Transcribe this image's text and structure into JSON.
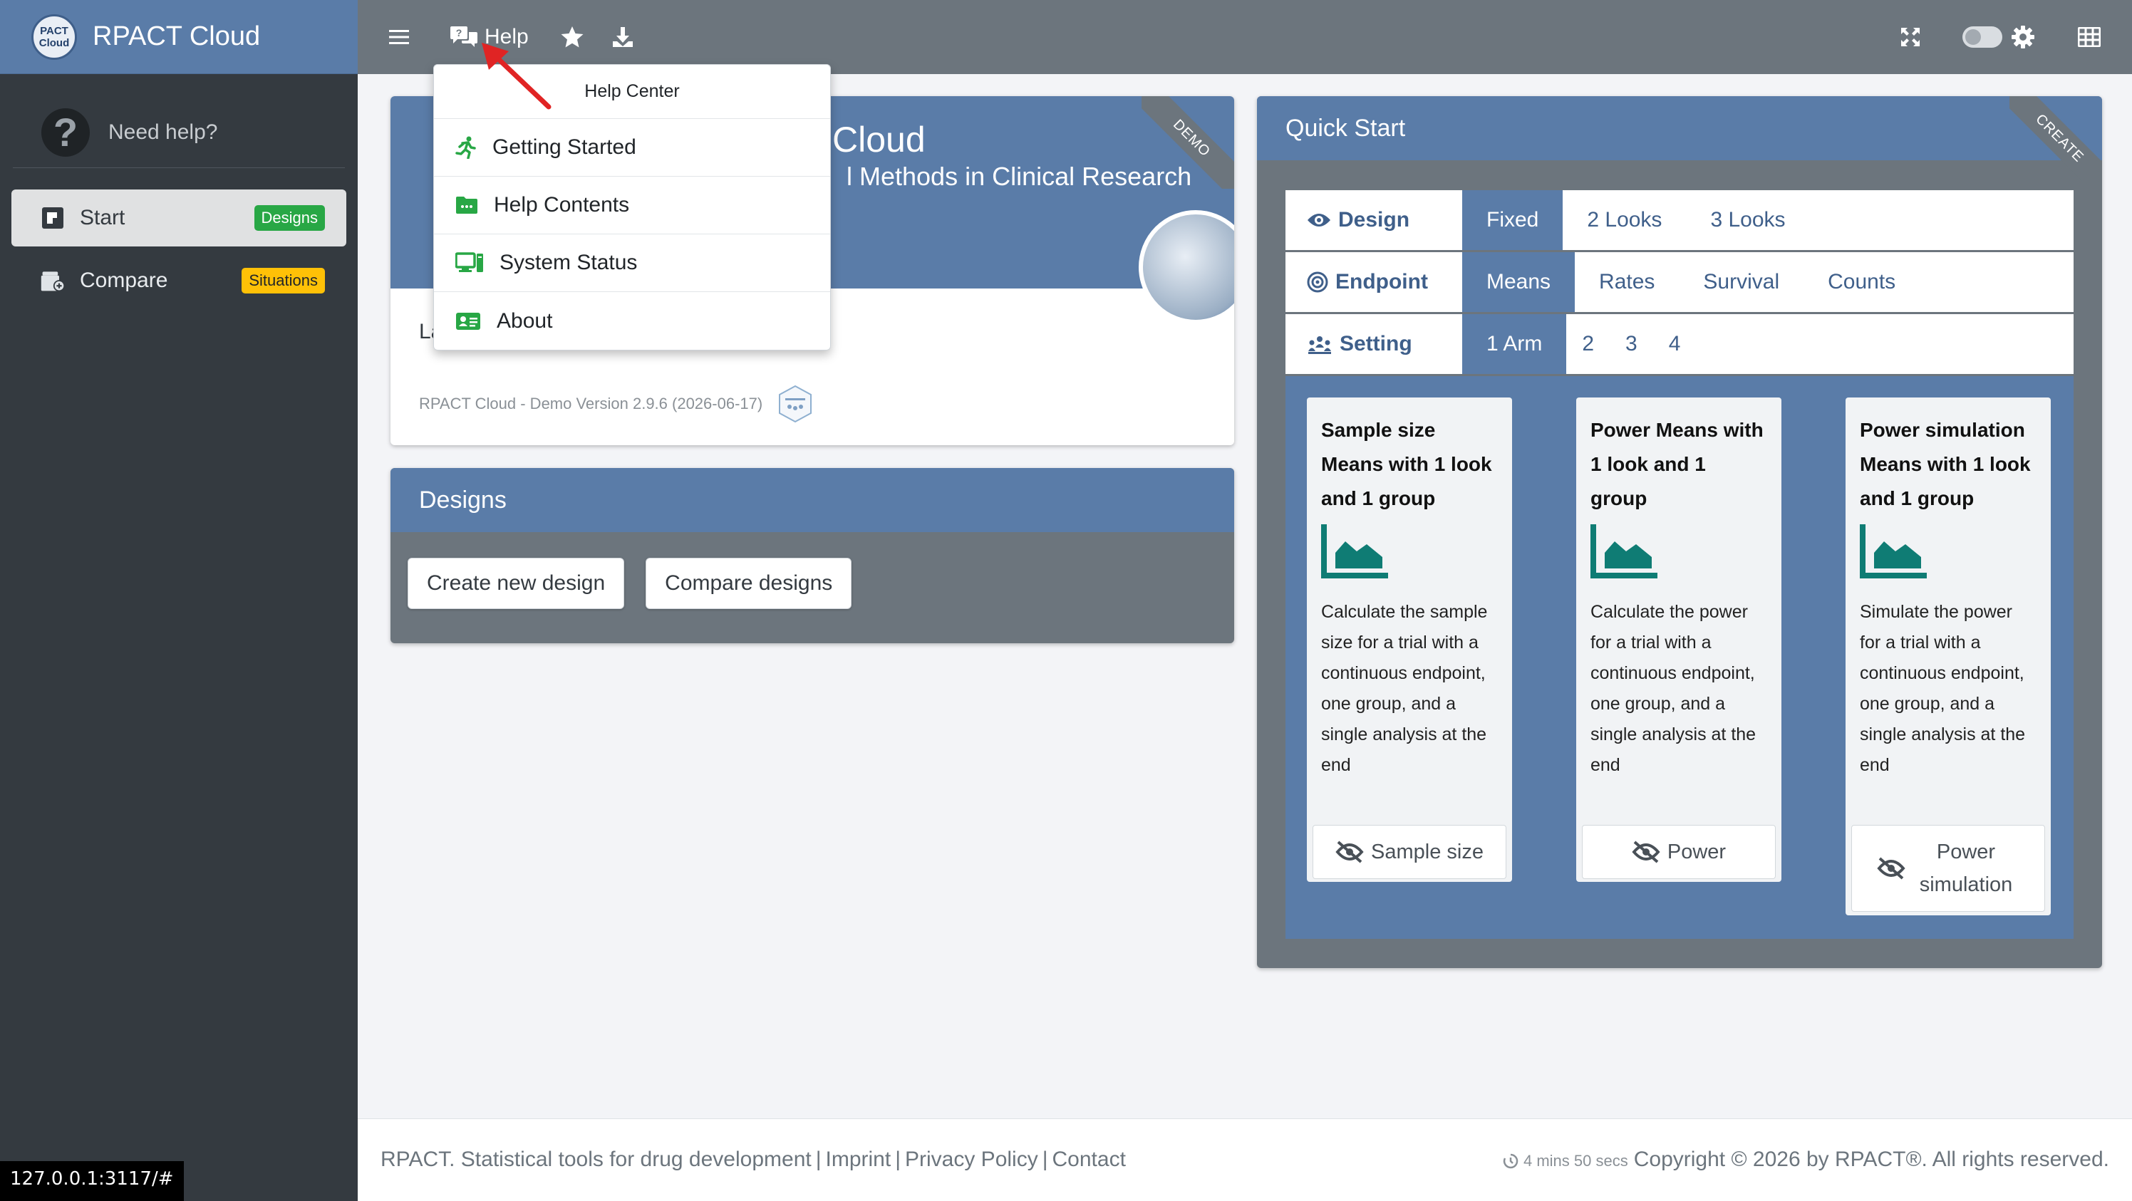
{
  "app": {
    "title": "RPACT Cloud",
    "logo_line1": "PACT",
    "logo_line2": "Cloud"
  },
  "sidebar": {
    "need_help": "Need help?",
    "items": [
      {
        "label": "Start",
        "badge": "Designs",
        "active": true,
        "icon": "start-icon",
        "badge_color": "#28a745"
      },
      {
        "label": "Compare",
        "badge": "Situations",
        "active": false,
        "icon": "compare-icon",
        "badge_color": "#ffc107"
      }
    ]
  },
  "topbar": {
    "help_label": "Help"
  },
  "help_menu": {
    "header": "Help Center",
    "items": [
      {
        "label": "Getting Started",
        "icon": "running-person-icon"
      },
      {
        "label": "Help Contents",
        "icon": "folder-icon"
      },
      {
        "label": "System Status",
        "icon": "desktop-icon"
      },
      {
        "label": "About",
        "icon": "id-card-icon"
      }
    ]
  },
  "welcome": {
    "title_fragment": "Cloud",
    "subtitle_fragment": "l Methods in Clinical Research",
    "body_fragment": "La",
    "version": "RPACT Cloud - Demo Version 2.9.6 (2026-06-17)",
    "ribbon": "DEMO"
  },
  "designs": {
    "title": "Designs",
    "buttons": [
      "Create new design",
      "Compare designs"
    ]
  },
  "quick_start": {
    "title": "Quick Start",
    "ribbon": "CREATE",
    "design": {
      "label": "Design",
      "tabs": [
        "Fixed",
        "2 Looks",
        "3 Looks"
      ],
      "active": 0
    },
    "endpoint": {
      "label": "Endpoint",
      "tabs": [
        "Means",
        "Rates",
        "Survival",
        "Counts"
      ],
      "active": 0
    },
    "setting": {
      "label": "Setting",
      "tabs": [
        "1 Arm",
        "2",
        "3",
        "4"
      ],
      "active": 0
    },
    "cards": [
      {
        "title": "Sample size Means with 1 look and 1 group",
        "description": "Calculate the sample size for a trial with a continuous endpoint, one group, and a single analysis at the end",
        "button": "Sample size"
      },
      {
        "title": "Power Means with 1 look and 1 group",
        "description": "Calculate the power for a trial with a continuous endpoint, one group, and a single analysis at the end",
        "button": "Power"
      },
      {
        "title": "Power simulation Means with 1 look and 1 group",
        "description": "Simulate the power for a trial with a continuous endpoint, one group, and a single analysis at the end",
        "button": "Power simulation"
      }
    ]
  },
  "footer": {
    "tagline": "RPACT. Statistical tools for drug development",
    "links": [
      "Imprint",
      "Privacy Policy",
      "Contact"
    ],
    "timer": "4 mins 50 secs",
    "copyright": "Copyright © 2026 by RPACT®. All rights reserved."
  },
  "status_url": "127.0.0.1:3117/#",
  "colors": {
    "brand_blue": "#5a7ca8",
    "sidebar_dark": "#343a40",
    "topbar_gray": "#6c757d",
    "green_icon": "#28a745",
    "teal_chart": "#0f7c74",
    "arrow_red": "#e02424"
  }
}
